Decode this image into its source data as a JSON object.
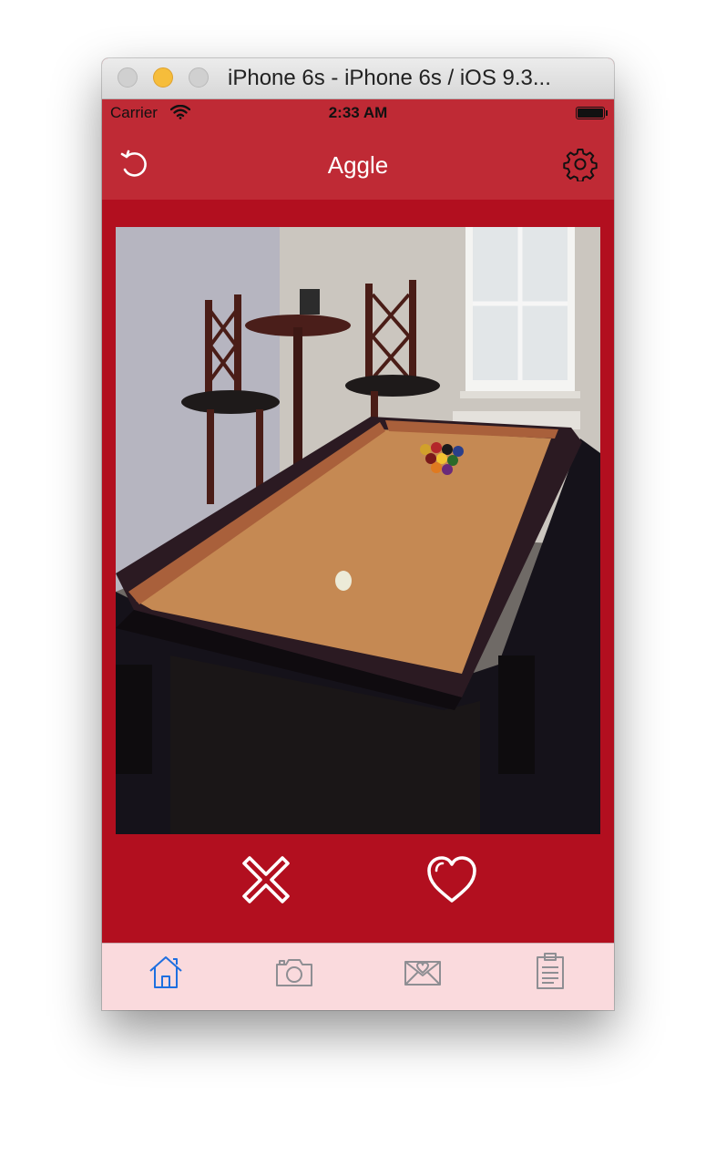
{
  "window": {
    "title": "iPhone 6s - iPhone 6s / iOS 9.3..."
  },
  "status_bar": {
    "carrier": "Carrier",
    "time": "2:33 AM",
    "wifi_icon": "wifi-icon",
    "battery_icon": "battery-icon"
  },
  "nav_bar": {
    "title": "Aggle",
    "left_icon": "refresh-icon",
    "right_icon": "gear-icon"
  },
  "card": {
    "image": "pool-table-photo"
  },
  "actions": {
    "dislike_icon": "x-icon",
    "like_icon": "heart-icon"
  },
  "tab_bar": {
    "items": [
      {
        "icon": "home-icon",
        "selected": true
      },
      {
        "icon": "camera-icon",
        "selected": false
      },
      {
        "icon": "envelope-heart-icon",
        "selected": false
      },
      {
        "icon": "clipboard-icon",
        "selected": false
      }
    ]
  },
  "colors": {
    "nav_bar": "#bf2a35",
    "background": "#b20f1f",
    "tab_bar": "#fadadd",
    "tab_selected": "#1e6fe0",
    "tab_unselected": "#8e8e93"
  }
}
